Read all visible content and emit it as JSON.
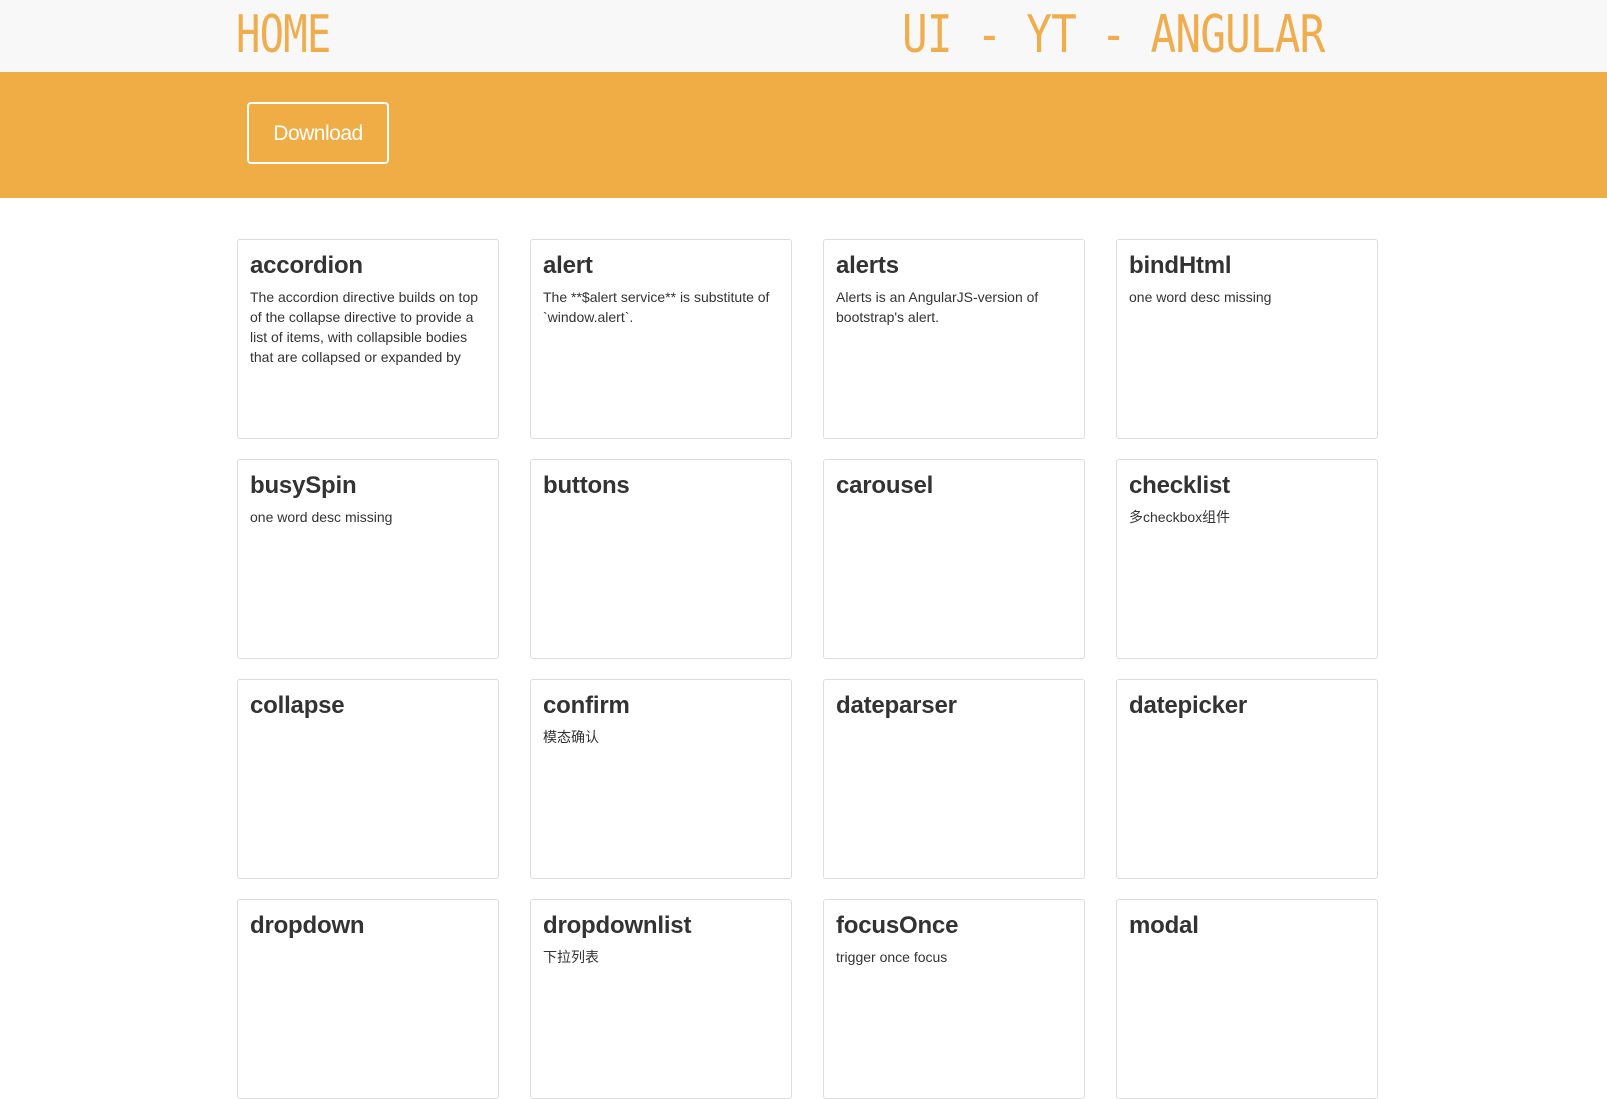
{
  "navbar": {
    "home_label": "HOME",
    "site_title": "UI - YT - ANGULAR"
  },
  "hero": {
    "download_label": "Download"
  },
  "colors": {
    "accent": "#f0ad4e",
    "hero_background": "#f0ad45",
    "navbar_background": "#f8f8f8",
    "card_border": "#dddddd",
    "text": "#333333"
  },
  "components": [
    {
      "name": "accordion",
      "desc": "The accordion directive builds on top of the collapse directive to provide a list of items, with collapsible bodies that are collapsed or expanded by"
    },
    {
      "name": "alert",
      "desc": "The **$alert service** is substitute of `window.alert`."
    },
    {
      "name": "alerts",
      "desc": "Alerts is an AngularJS-version of bootstrap's alert."
    },
    {
      "name": "bindHtml",
      "desc": "one word desc missing"
    },
    {
      "name": "busySpin",
      "desc": "one word desc missing"
    },
    {
      "name": "buttons",
      "desc": ""
    },
    {
      "name": "carousel",
      "desc": ""
    },
    {
      "name": "checklist",
      "desc": "多checkbox组件"
    },
    {
      "name": "collapse",
      "desc": ""
    },
    {
      "name": "confirm",
      "desc": "模态确认"
    },
    {
      "name": "dateparser",
      "desc": ""
    },
    {
      "name": "datepicker",
      "desc": ""
    },
    {
      "name": "dropdown",
      "desc": ""
    },
    {
      "name": "dropdownlist",
      "desc": "下拉列表"
    },
    {
      "name": "focusOnce",
      "desc": "trigger once focus"
    },
    {
      "name": "modal",
      "desc": ""
    }
  ]
}
